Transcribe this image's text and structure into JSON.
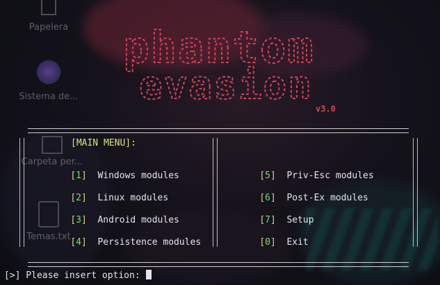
{
  "desktop": {
    "icons": [
      {
        "label": "Papelera"
      },
      {
        "label": "Sistema de..."
      },
      {
        "label": "Carpeta per..."
      },
      {
        "label": "Temas.txt"
      }
    ]
  },
  "banner": {
    "logo_line1": "phantom",
    "logo_line2": "evasion",
    "version": "v3.0"
  },
  "menu": {
    "title": "[MAIN MENU]",
    "title_suffix": ":",
    "left_items": [
      {
        "num": "1",
        "label": "Windows modules"
      },
      {
        "num": "2",
        "label": "Linux modules"
      },
      {
        "num": "3",
        "label": "Android modules"
      },
      {
        "num": "4",
        "label": "Persistence modules"
      }
    ],
    "right_items": [
      {
        "num": "5",
        "label": "Priv-Esc modules"
      },
      {
        "num": "6",
        "label": "Post-Ex modules"
      },
      {
        "num": "7",
        "label": "Setup"
      },
      {
        "num": "0",
        "label": "Exit"
      }
    ]
  },
  "prompt": {
    "text": "[>] Please insert option: "
  },
  "colors": {
    "logo_red": "#d8415a",
    "number_green": "#6fe06f",
    "bracket_yellow": "#d9d37a",
    "title_yellow": "#d9e27a"
  }
}
